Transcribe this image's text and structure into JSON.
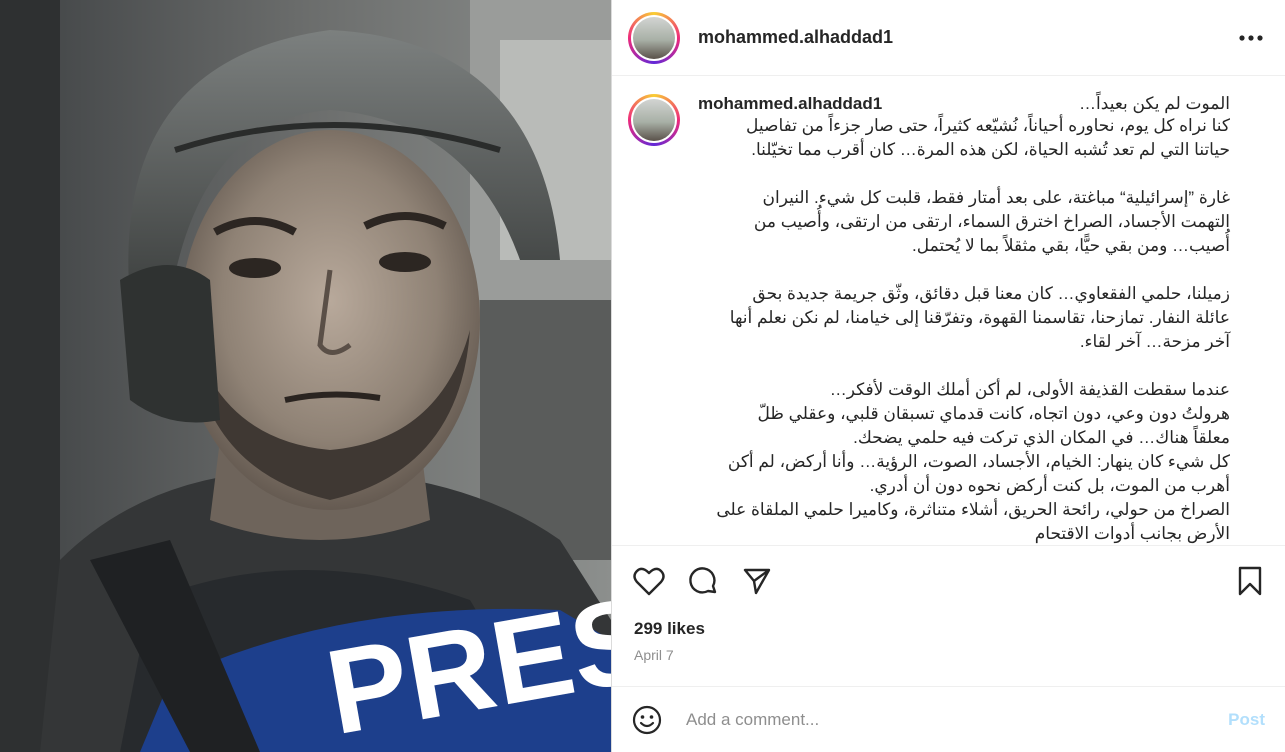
{
  "post": {
    "username": "mohammed.alhaddad1",
    "caption_first_line": "الموت لم يكن بعيداً…",
    "caption_body": "كنا نراه كل يوم، نحاوره أحياناً، نُشيّعه كثيراً، حتى صار جزءاً من تفاصيل\nحياتنا التي لم تعد تُشبه الحياة، لكن هذه المرة… كان أقرب مما تخيّلنا.\n\nغارة ”إسرائيلية“ مباغتة، على بعد أمتار فقط، قلبت كل شيء. النيران\nالتهمت الأجساد، الصراخ اخترق السماء، ارتقى من ارتقى، وأُصيب من\nأُصيب… ومن بقي حيًّا، بقي مثقلاً بما لا يُحتمل.\n\nزميلنا، حلمي الفقعاوي… كان معنا قبل دقائق، وثّق جريمة جديدة بحق\nعائلة النفار. تمازحنا، تقاسمنا القهوة، وتفرّقنا إلى خيامنا، لم نكن نعلم أنها\nآخر مزحة… آخر لقاء.\n\nعندما سقطت القذيفة الأولى، لم أكن أملك الوقت لأفكر…\nهرولتُ دون وعي، دون اتجاه، كانت قدماي تسبقان قلبي، وعقلي ظلّ\nمعلقاً هناك… في المكان الذي تركت فيه حلمي يضحك.\nكل شيء كان ينهار: الخيام، الأجساد، الصوت، الرؤية… وأنا أركض، لم أكن\nأهرب من الموت، بل كنت أركض نحوه دون أن أدري.\nالصراخ من حولي، رائحة الحريق، أشلاء متناثرة، وكاميرا حلمي الملقاة على\nالأرض بجانب أدوات الاقتحام",
    "likes": "299 likes",
    "date": "April 7"
  },
  "comment": {
    "placeholder": "Add a comment...",
    "post_label": "Post"
  },
  "icons": {
    "more": "more-options-icon",
    "like": "heart-icon",
    "comment": "comment-icon",
    "share": "share-icon",
    "save": "bookmark-icon",
    "emoji": "emoji-icon"
  },
  "colors": {
    "post_button": "#b2dffc",
    "muted_text": "#8e8e8e",
    "vest_label": "#ffffff",
    "vest_blue": "#1d3f8c"
  },
  "media": {
    "vest_text": "PRES"
  }
}
